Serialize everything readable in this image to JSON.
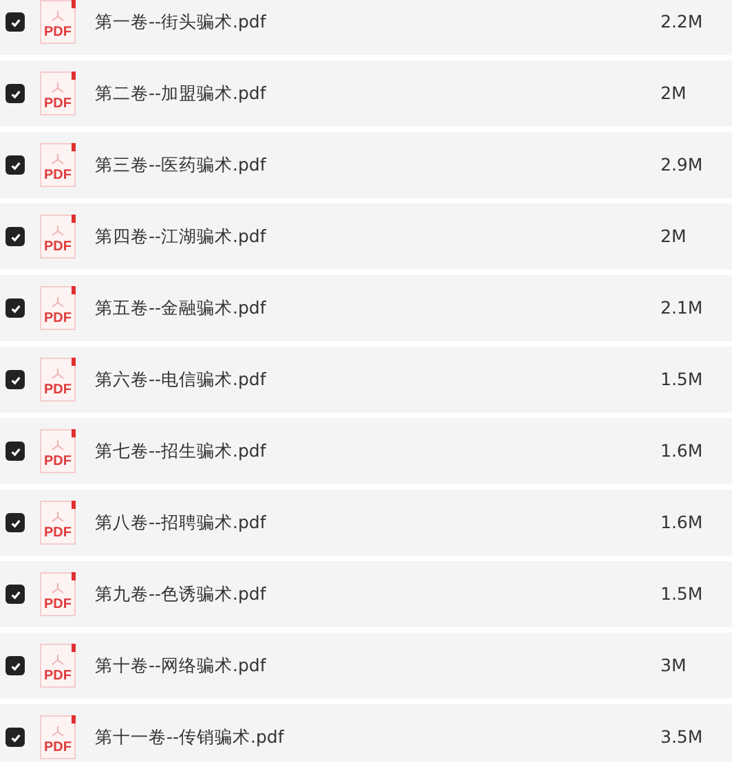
{
  "files": [
    {
      "name": "第一卷--街头骗术.pdf",
      "size": "2.2M",
      "icon_text": "PDF",
      "checked": true
    },
    {
      "name": "第二卷--加盟骗术.pdf",
      "size": "2M",
      "icon_text": "PDF",
      "checked": true
    },
    {
      "name": "第三卷--医药骗术.pdf",
      "size": "2.9M",
      "icon_text": "PDF",
      "checked": true
    },
    {
      "name": "第四卷--江湖骗术.pdf",
      "size": "2M",
      "icon_text": "PDF",
      "checked": true
    },
    {
      "name": "第五卷--金融骗术.pdf",
      "size": "2.1M",
      "icon_text": "PDF",
      "checked": true
    },
    {
      "name": "第六卷--电信骗术.pdf",
      "size": "1.5M",
      "icon_text": "PDF",
      "checked": true
    },
    {
      "name": "第七卷--招生骗术.pdf",
      "size": "1.6M",
      "icon_text": "PDF",
      "checked": true
    },
    {
      "name": "第八卷--招聘骗术.pdf",
      "size": "1.6M",
      "icon_text": "PDF",
      "checked": true
    },
    {
      "name": "第九卷--色诱骗术.pdf",
      "size": "1.5M",
      "icon_text": "PDF",
      "checked": true
    },
    {
      "name": "第十卷--网络骗术.pdf",
      "size": "3M",
      "icon_text": "PDF",
      "checked": true
    },
    {
      "name": "第十一卷--传销骗术.pdf",
      "size": "3.5M",
      "icon_text": "PDF",
      "checked": true
    }
  ]
}
